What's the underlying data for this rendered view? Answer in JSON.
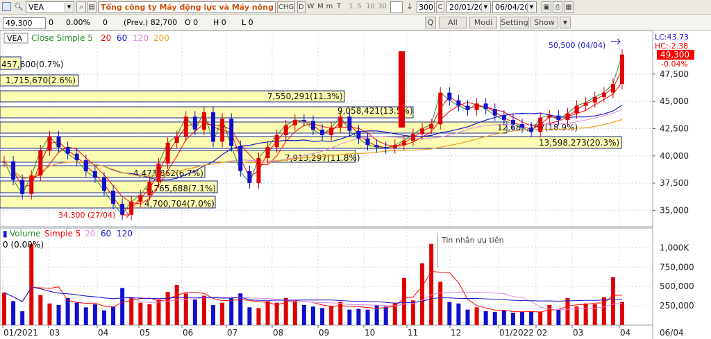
{
  "toolbar": {
    "symbol": "VEA",
    "company": "Tổng công ty Máy động lực và Máy nông ng",
    "chg": "CHG",
    "periods": [
      "D",
      "W",
      "M",
      "m",
      "T"
    ],
    "intervals": [
      "1",
      "5",
      "10",
      "30"
    ],
    "bar_count": "300",
    "c_label": "C",
    "date_from": "20/01/202",
    "date_to": "06/04/202"
  },
  "quote": {
    "price": "49,300",
    "change": "0",
    "pct": "0.00%",
    "vol": "0",
    "prev": "(Prev.) 82,700",
    "o": "O 0",
    "h": "H 0",
    "l": "L 0",
    "buttons": [
      "Q",
      "All",
      "Modi",
      "Setting",
      "Show"
    ]
  },
  "price_panel": {
    "legend_symbol": "VEA",
    "legend_line": "Close Simple 5",
    "ma_periods": [
      "20",
      "60",
      "120",
      "200"
    ],
    "colors": {
      "close": "#2e8b2e",
      "ma5": "#ff0000",
      "ma20": "#ff0000",
      "ma60": "#1414cc",
      "ma120": "#dd88dd",
      "ma200": "#e8a020",
      "up": "#e00000",
      "down": "#1010d0"
    },
    "lc": "LC:43.73",
    "hc": "HC:-2.38",
    "last_price": "49,300",
    "last_pct": "-0.04%",
    "high_note": "50,500 (04/04)",
    "low_note": "34,300 (27/04)",
    "yaxis": [
      "47,500",
      "45,000",
      "42,500",
      "40,000",
      "37,500",
      "35,000"
    ]
  },
  "volume_profile": [
    {
      "label": "457,600(0.7%)"
    },
    {
      "label": "1,715,670(2.6%)"
    },
    {
      "label": "7,550,291(11.3%)"
    },
    {
      "label": "9,058,421(13.5%)"
    },
    {
      "label": "12,681,157(18.9%)"
    },
    {
      "label": "13,598,273(20.3%)"
    },
    {
      "label": "7,913,297(11.8%)"
    },
    {
      "label": "4,473,862(6.7%)"
    },
    {
      "label": "4,765,688(7.1%)"
    },
    {
      "label": "4,700,704(7.0%)"
    }
  ],
  "volume_panel": {
    "legend": "Volume",
    "legend_ma": "Simple 5",
    "ma_periods": [
      "20",
      "60",
      "120"
    ],
    "info": "0 (0.00%)",
    "tooltip": "Tin nhắn ưu tiên",
    "yaxis": [
      "1,000K",
      "750,000",
      "500,000",
      "250,000"
    ]
  },
  "xaxis": [
    "01/2021",
    "03",
    "04",
    "05",
    "06",
    "07",
    "08",
    "09",
    "10",
    "11",
    "12",
    "01/2022",
    "02",
    "03",
    "04"
  ],
  "xaxis_right": "06/04",
  "chart_data": {
    "type": "candlestick",
    "title": "VEA",
    "x_range": [
      "01/2021",
      "04/2022"
    ],
    "ylim": [
      33500,
      51500
    ],
    "volume_ylim": [
      0,
      1200000
    ],
    "grid": true,
    "series": [
      {
        "name": "Close Simple 5",
        "values": [
          39500,
          37800,
          36500,
          38200,
          40500,
          41800,
          40800,
          40200,
          39600,
          38600,
          38000,
          36800,
          35600,
          34600,
          35800,
          36400,
          37600,
          39300,
          41200,
          41800,
          43600,
          42400,
          44000,
          41300,
          43400,
          40900,
          38600,
          37500,
          39800,
          40800,
          41900,
          42800,
          43300,
          43200,
          42400,
          41900,
          42600,
          43600,
          42300,
          41600,
          41000,
          40800,
          40700,
          41000,
          41400,
          42000,
          42500,
          42900,
          45800,
          45100,
          44600,
          44200,
          44800,
          44300,
          43700,
          43300,
          42900,
          42600,
          42200,
          43500,
          43700,
          43300,
          43900,
          44600,
          44900,
          45400,
          45800,
          46600,
          49300
        ]
      }
    ],
    "volume": {
      "values": [
        420000,
        310000,
        180000,
        1050000,
        390000,
        280000,
        260000,
        350000,
        290000,
        230000,
        270000,
        190000,
        240000,
        480000,
        360000,
        290000,
        270000,
        330000,
        430000,
        520000,
        410000,
        330000,
        380000,
        260000,
        290000,
        350000,
        410000,
        230000,
        220000,
        310000,
        290000,
        350000,
        320000,
        260000,
        240000,
        220000,
        250000,
        300000,
        200000,
        210000,
        200000,
        260000,
        240000,
        280000,
        610000,
        320000,
        800000,
        1050000,
        560000,
        300000,
        280000,
        200000,
        230000,
        180000,
        170000,
        190000,
        160000,
        170000,
        180000,
        170000,
        260000,
        200000,
        350000,
        240000,
        280000,
        270000,
        360000,
        620000,
        300000
      ]
    }
  }
}
